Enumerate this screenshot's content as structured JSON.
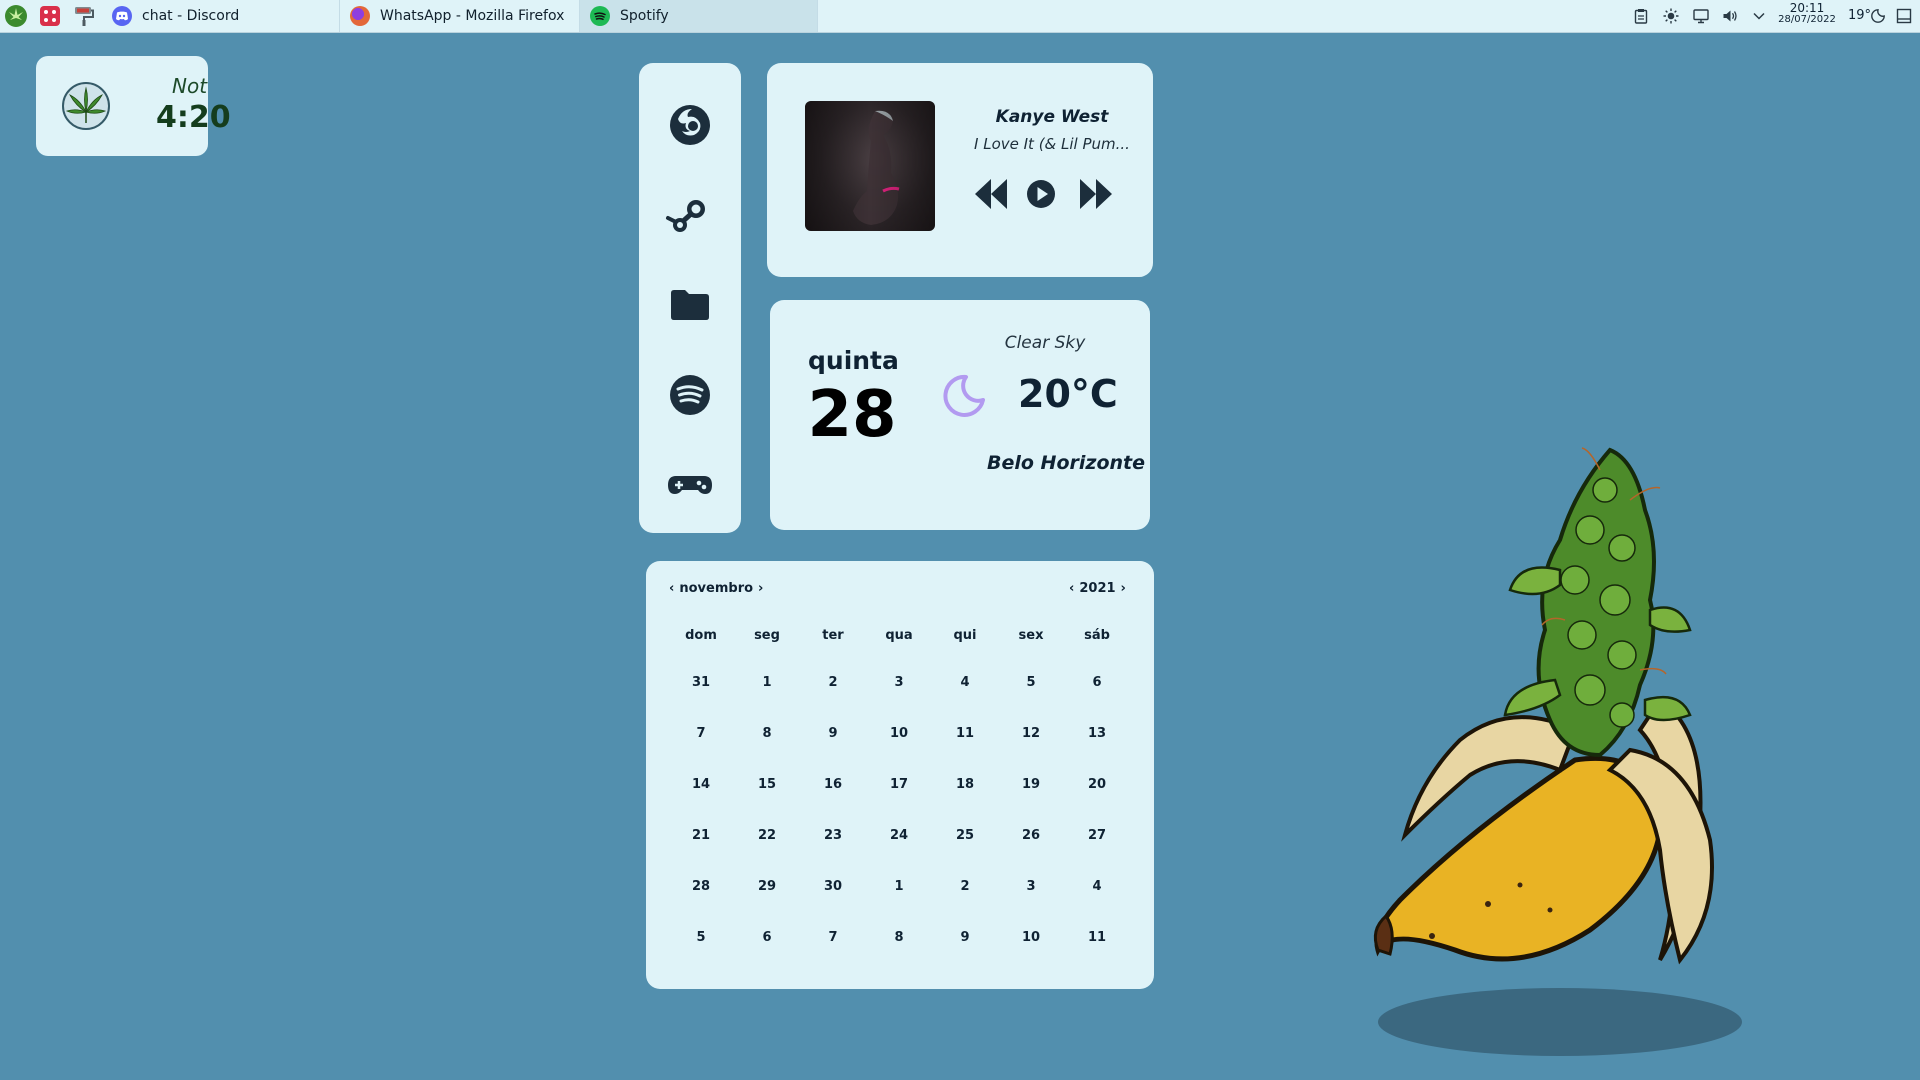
{
  "taskbar": {
    "launchers": [
      {
        "name": "cannabis-launcher-icon",
        "color": "#3b8a2e"
      },
      {
        "name": "dice-launcher-icon",
        "color": "#d9304a"
      },
      {
        "name": "paint-roller-launcher-icon",
        "color": "#6b7b84"
      }
    ],
    "tasks": [
      {
        "label": "chat - Discord",
        "icon": "discord-icon",
        "color": "#5865f2"
      },
      {
        "label": "WhatsApp - Mozilla Firefox",
        "icon": "firefox-icon",
        "color": "#e3683a"
      },
      {
        "label": "Spotify",
        "icon": "spotify-icon",
        "color": "#1db954"
      }
    ],
    "tray": {
      "clock_time": "20:11",
      "clock_date": "28/07/2022",
      "weather": "19°",
      "icons": [
        "clipboard-icon",
        "brightness-icon",
        "display-icon",
        "volume-icon",
        "chevron-down-icon",
        "night-mode-icon",
        "show-desktop-icon"
      ]
    }
  },
  "four_twenty": {
    "prefix": "Not",
    "time": "4:20"
  },
  "launcher_apps": [
    "firefox-icon",
    "steam-icon",
    "folder-icon",
    "spotify-icon",
    "gamepad-icon"
  ],
  "player": {
    "artist": "Kanye West",
    "track": "I Love It (& Lil Pum...",
    "controls": [
      "previous-icon",
      "play-icon",
      "next-icon"
    ]
  },
  "weather": {
    "day_name": "quinta",
    "day_number": "28",
    "condition": "Clear Sky",
    "temperature": "20°C",
    "city": "Belo Horizonte",
    "icon": "moon-icon",
    "icon_color": "#b29af0"
  },
  "calendar": {
    "month": "novembro",
    "year": "2021",
    "weekdays": [
      "dom",
      "seg",
      "ter",
      "qua",
      "qui",
      "sex",
      "sáb"
    ],
    "weeks": [
      [
        "31",
        "1",
        "2",
        "3",
        "4",
        "5",
        "6"
      ],
      [
        "7",
        "8",
        "9",
        "10",
        "11",
        "12",
        "13"
      ],
      [
        "14",
        "15",
        "16",
        "17",
        "18",
        "19",
        "20"
      ],
      [
        "21",
        "22",
        "23",
        "24",
        "25",
        "26",
        "27"
      ],
      [
        "28",
        "29",
        "30",
        "1",
        "2",
        "3",
        "4"
      ],
      [
        "5",
        "6",
        "7",
        "8",
        "9",
        "10",
        "11"
      ]
    ]
  },
  "colors": {
    "background": "#528fae",
    "card": "#dff3f8",
    "text": "#0f2233"
  }
}
